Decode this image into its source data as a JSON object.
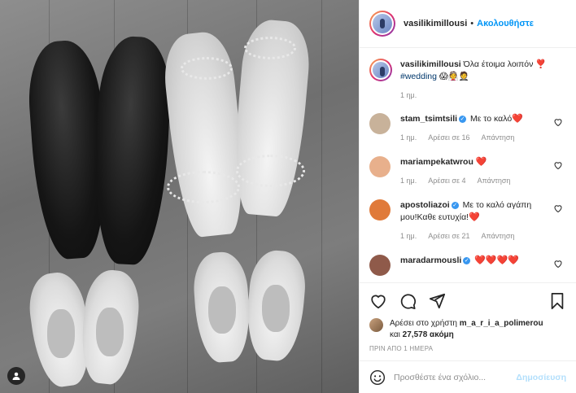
{
  "post": {
    "username": "vasilikimillousi",
    "separator": "•",
    "follow_label": "Ακολουθήστε",
    "caption_text": "Όλα έτοιμα λοιπόν ❣️",
    "caption_tag": "#wedding",
    "caption_emoji": "😱👰🤵",
    "caption_time": "1 ημ."
  },
  "comments": [
    {
      "username": "stam_tsimtsili",
      "verified": true,
      "text": "Με το καλό",
      "hearts": "❤️",
      "time": "1 ημ.",
      "likes": "Αρέσει σε 16",
      "reply": "Απάντηση",
      "avatar_color": "#c8b29a"
    },
    {
      "username": "mariampekatwrou",
      "verified": false,
      "text": "",
      "hearts": "❤️",
      "time": "1 ημ.",
      "likes": "Αρέσει σε 4",
      "reply": "Απάντηση",
      "avatar_color": "#e8b08c"
    },
    {
      "username": "apostoliazoi",
      "verified": true,
      "text": "Με το καλό αγάπη μου!Καθε ευτυχία!",
      "hearts": "❤️",
      "time": "1 ημ.",
      "likes": "Αρέσει σε 21",
      "reply": "Απάντηση",
      "avatar_color": "#e07a3a"
    },
    {
      "username": "maradarmousli",
      "verified": true,
      "text": "",
      "hearts": "❤️❤️❤️❤️",
      "time": "",
      "likes": "",
      "reply": "",
      "avatar_color": "#8f5a4a"
    }
  ],
  "liked_by": {
    "prefix": "Αρέσει στο χρήστη",
    "user": "m_a_r_i_a_polimerou",
    "and": "και",
    "count": "27,578",
    "suffix": "ακόμη"
  },
  "time_ago": "ΠΡΙΝ ΑΠΟ 1 ΗΜΕΡΑ",
  "add_comment": {
    "placeholder": "Προσθέστε ένα σχόλιο...",
    "post_label": "Δημοσίευση"
  },
  "icons": {
    "like": "heart-icon",
    "comment": "comment-icon",
    "share": "share-icon",
    "save": "bookmark-icon",
    "emoji": "emoji-icon",
    "user_tags": "user-tag-icon"
  },
  "colors": {
    "accent": "#0095f6",
    "heart": "#ed1c24",
    "muted": "#8e8e8e",
    "verified": "#3897f0"
  }
}
